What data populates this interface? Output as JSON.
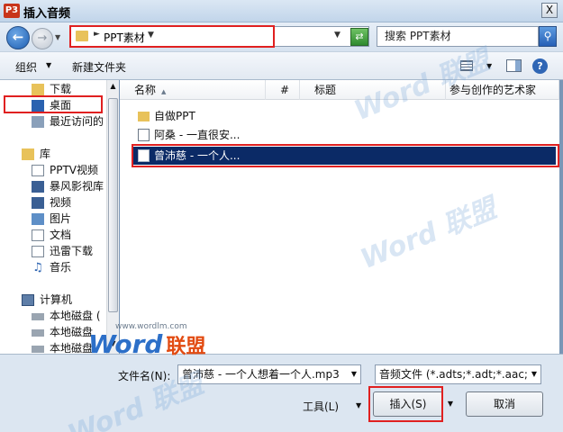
{
  "window": {
    "app_icon_text": "P3",
    "title": "插入音频",
    "close_glyph": "X"
  },
  "address_bar": {
    "path": "PPT素材",
    "search_placeholder": "搜索 PPT素材"
  },
  "toolbar": {
    "organize_label": "组织",
    "new_folder_label": "新建文件夹"
  },
  "nav_pane": {
    "items": [
      {
        "label": "下载",
        "icon": "download-folder-icon"
      },
      {
        "label": "桌面",
        "icon": "desktop-icon"
      },
      {
        "label": "最近访问的",
        "icon": "recent-places-icon"
      },
      {
        "label": "库",
        "icon": "library-icon"
      },
      {
        "label": "PPTV视频",
        "icon": "library-video-icon"
      },
      {
        "label": "暴风影视库",
        "icon": "library-video-icon"
      },
      {
        "label": "视频",
        "icon": "video-library-icon"
      },
      {
        "label": "图片",
        "icon": "pictures-library-icon"
      },
      {
        "label": "文档",
        "icon": "documents-library-icon"
      },
      {
        "label": "迅雷下载",
        "icon": "download-library-icon"
      },
      {
        "label": "音乐",
        "icon": "music-library-icon"
      },
      {
        "label": "计算机",
        "icon": "computer-icon"
      },
      {
        "label": "本地磁盘 (",
        "icon": "disk-icon"
      },
      {
        "label": "本地磁盘",
        "icon": "disk-icon"
      },
      {
        "label": "本地磁盘",
        "icon": "disk-icon"
      }
    ]
  },
  "file_list": {
    "columns": [
      "名称",
      "#",
      "标题",
      "参与创作的艺术家"
    ],
    "rows": [
      {
        "name": "自做PPT",
        "type": "folder"
      },
      {
        "name": "阿桑 - 一直很安...",
        "type": "audio"
      },
      {
        "name": "曾沛慈 - 一个人...",
        "type": "audio",
        "selected": true
      }
    ]
  },
  "bottom": {
    "filename_label": "文件名(N):",
    "filename_value": "曾沛慈 - 一个人想着一个人.mp3",
    "filetype_value": "音频文件 (*.adts;*.adt;*.aac;*.a",
    "tools_label": "工具(L)",
    "insert_label": "插入(S)",
    "cancel_label": "取消"
  },
  "watermark": {
    "brand": "Word",
    "brand_cn": "联盟",
    "url": "www.wordlm.com"
  },
  "colors": {
    "highlight_red": "#e02020",
    "selection_bg": "#0b2a66",
    "dialog_bg": "#dce6f1"
  }
}
